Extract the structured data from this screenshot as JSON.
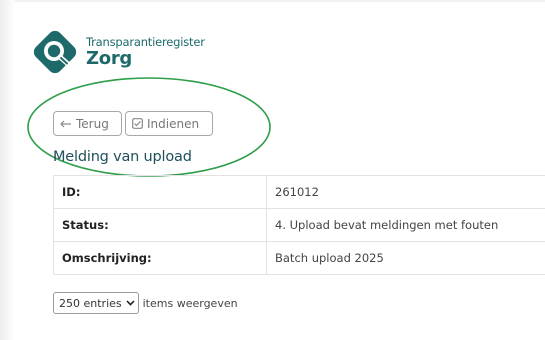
{
  "brand": {
    "line1": "Transparantieregister",
    "line2": "Zorg"
  },
  "toolbar": {
    "back_label": "Terug",
    "submit_label": "Indienen"
  },
  "page_title": "Melding van upload",
  "details": [
    {
      "label": "ID:",
      "value": "261012"
    },
    {
      "label": "Status:",
      "value": "4. Upload bevat meldingen met fouten"
    },
    {
      "label": "Omschrijving:",
      "value": "Batch upload 2025"
    }
  ],
  "pager": {
    "selected": "250 entries",
    "label": "items weergeven"
  },
  "colors": {
    "brand_teal": "#1e6a6a",
    "annotation_green": "#2e9e4a"
  }
}
